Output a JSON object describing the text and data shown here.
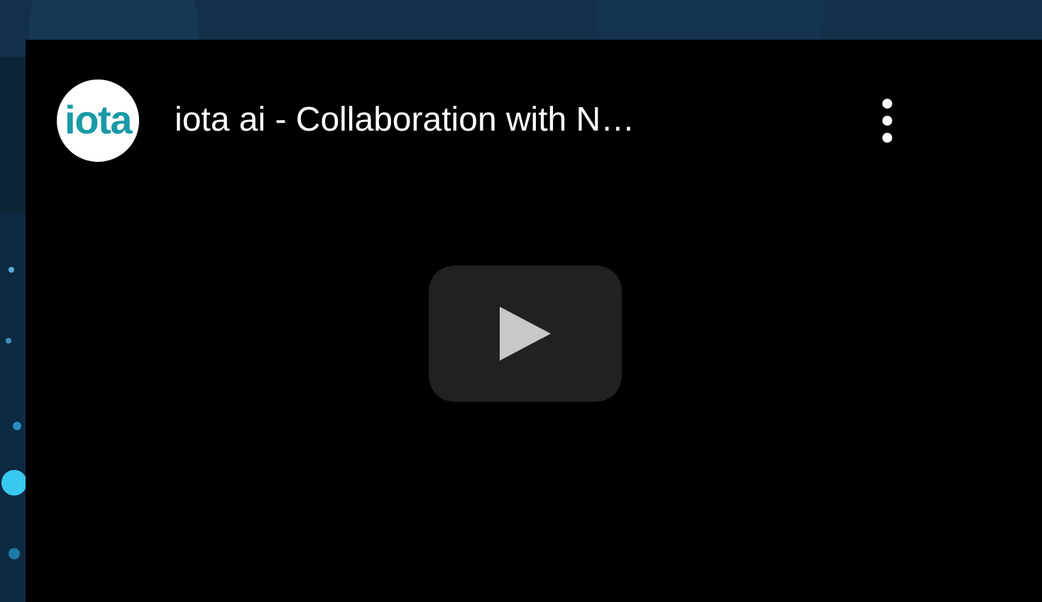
{
  "video": {
    "channel_logo_text": "iota",
    "title": "iota ai - Collaboration with N…"
  }
}
